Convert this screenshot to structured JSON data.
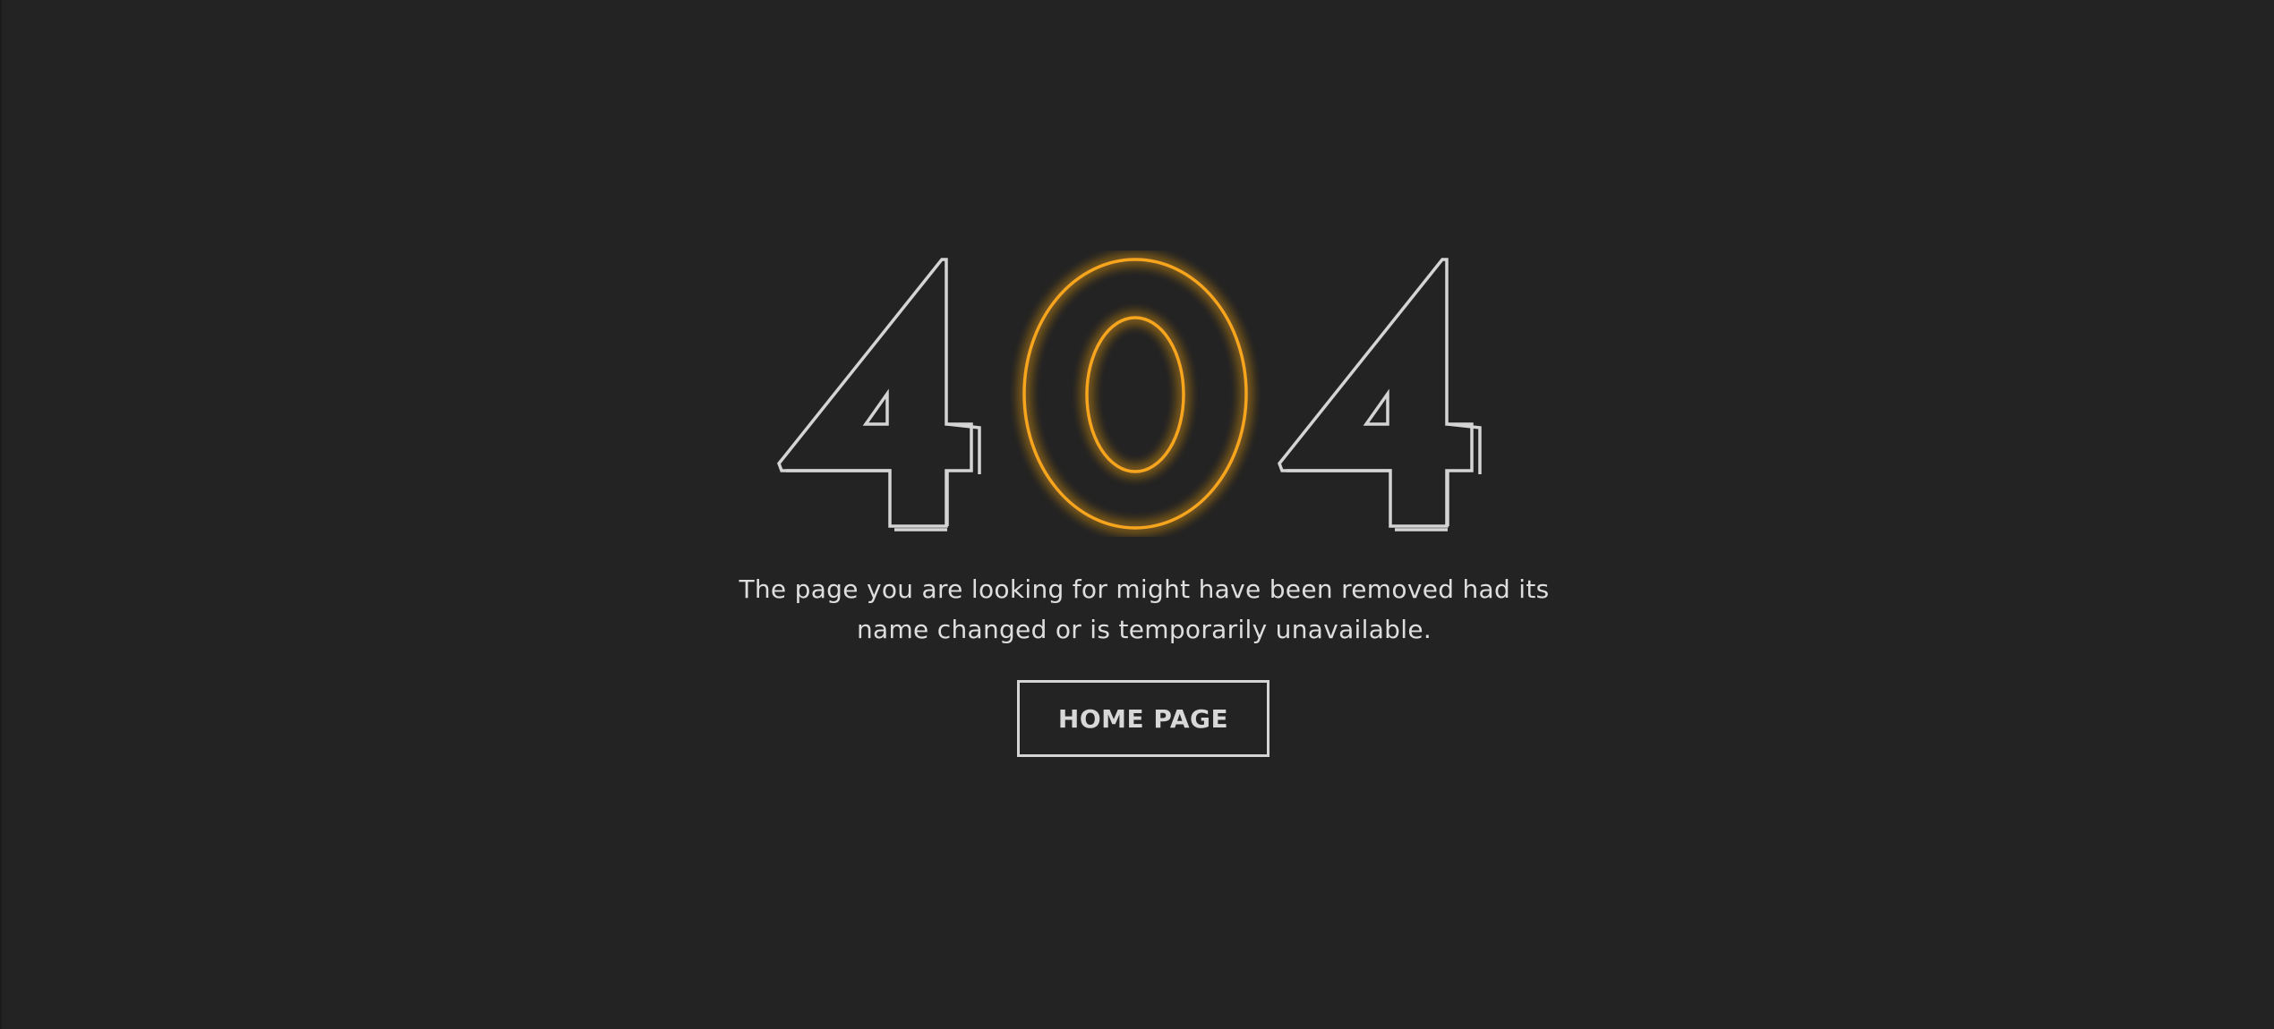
{
  "error_code": {
    "digit_left": "4",
    "digit_center": "0",
    "digit_right": "4"
  },
  "message": {
    "line1": "The page you are looking for might have been removed had its",
    "line2": "name changed or is temporarily unavailable."
  },
  "home_button": {
    "label": "HOME PAGE"
  },
  "colors": {
    "background": "#232323",
    "outline": "#d4d4d4",
    "accent": "#f6a51c"
  }
}
